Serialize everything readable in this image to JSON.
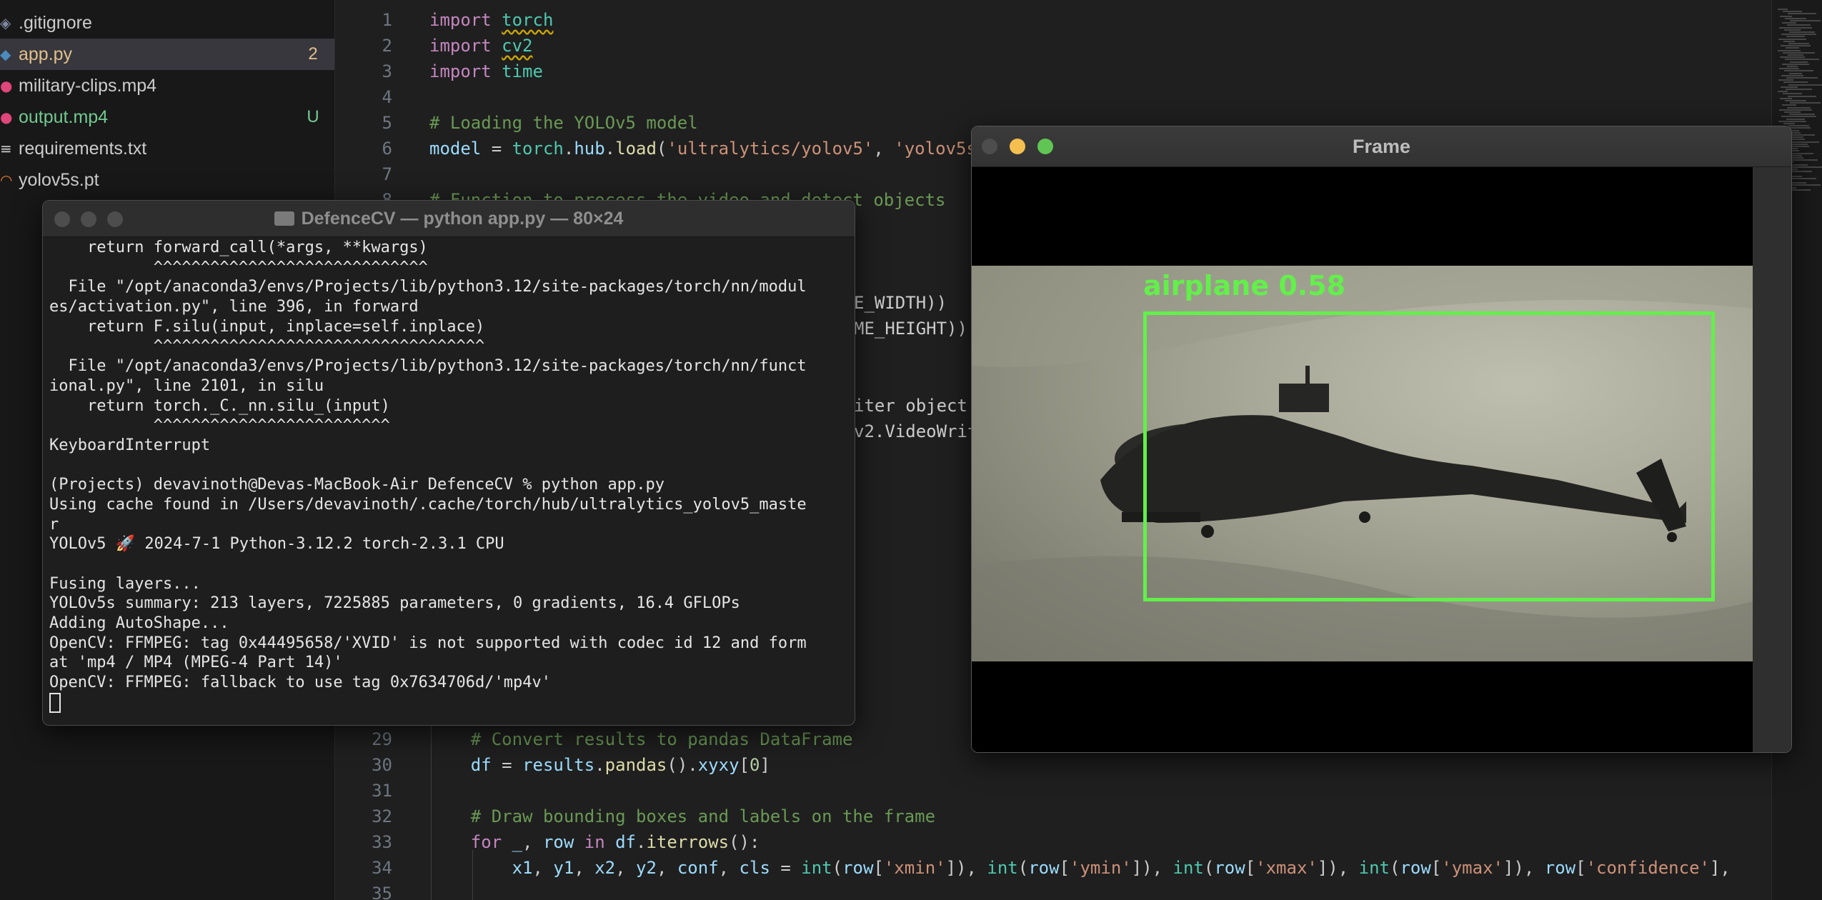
{
  "explorer": {
    "files": [
      {
        "name": ".gitignore",
        "icon": "gitignore-icon",
        "icon_glyph": "◈",
        "icon_color": "#7e8aa0",
        "color": "#cccccc",
        "badge": ""
      },
      {
        "name": "app.py",
        "icon": "python-file-icon",
        "icon_glyph": "◆",
        "icon_color": "#4b8bbe",
        "color": "#e2c08d",
        "badge": "2",
        "selected": true
      },
      {
        "name": "military-clips.mp4",
        "icon": "video-file-icon",
        "icon_glyph": "●",
        "icon_color": "#e0457b",
        "color": "#cccccc",
        "badge": ""
      },
      {
        "name": "output.mp4",
        "icon": "video-file-icon",
        "icon_glyph": "●",
        "icon_color": "#e0457b",
        "color": "#73c991",
        "badge": "U"
      },
      {
        "name": "requirements.txt",
        "icon": "text-file-icon",
        "icon_glyph": "≡",
        "icon_color": "#cccccc",
        "color": "#cccccc",
        "badge": ""
      },
      {
        "name": "yolov5s.pt",
        "icon": "rss-file-icon",
        "icon_glyph": "◠",
        "icon_color": "#e37933",
        "color": "#cccccc",
        "badge": ""
      }
    ]
  },
  "editor": {
    "top_lines": [
      {
        "n": "1",
        "tokens": [
          [
            "kw",
            "import "
          ],
          [
            "mod sq",
            "torch"
          ]
        ]
      },
      {
        "n": "2",
        "tokens": [
          [
            "kw",
            "import "
          ],
          [
            "mod sq",
            "cv2"
          ]
        ]
      },
      {
        "n": "3",
        "tokens": [
          [
            "kw",
            "import "
          ],
          [
            "mod",
            "time"
          ]
        ]
      },
      {
        "n": "4",
        "tokens": []
      },
      {
        "n": "5",
        "tokens": [
          [
            "cm",
            "# Loading the YOLOv5 model"
          ]
        ]
      },
      {
        "n": "6",
        "tokens": [
          [
            "var",
            "model"
          ],
          [
            "",
            " = "
          ],
          [
            "mod",
            "torch"
          ],
          [
            "",
            "."
          ],
          [
            "var",
            "hub"
          ],
          [
            "",
            "."
          ],
          [
            "fn",
            "load"
          ],
          [
            "",
            "("
          ],
          [
            "str",
            "'ultralytics/yolov5'"
          ],
          [
            "",
            ", "
          ],
          [
            "str",
            "'yolov5s'"
          ]
        ]
      },
      {
        "n": "7",
        "tokens": []
      },
      {
        "n": "8",
        "tokens": [
          [
            "cm",
            "# Function to process the video and detect objects"
          ]
        ]
      }
    ],
    "mid_fragments": [
      {
        "text": "E_WIDTH))",
        "line": 12
      },
      {
        "text": "ME_HEIGHT))",
        "line": 13
      },
      {
        "text": "iter object",
        "line": 16
      },
      {
        "text": "v2.VideoWrit",
        "line": 17
      }
    ],
    "bottom_lines": [
      {
        "n": "29",
        "tokens": [
          [
            "cm",
            "    # Convert results to pandas DataFrame"
          ]
        ]
      },
      {
        "n": "30",
        "tokens": [
          [
            "",
            "    "
          ],
          [
            "var",
            "df"
          ],
          [
            "",
            " = "
          ],
          [
            "var",
            "results"
          ],
          [
            "",
            "."
          ],
          [
            "fn",
            "pandas"
          ],
          [
            "",
            "()."
          ],
          [
            "var",
            "xyxy"
          ],
          [
            "",
            "["
          ],
          [
            "num",
            "0"
          ],
          [
            "",
            "]"
          ]
        ]
      },
      {
        "n": "31",
        "tokens": []
      },
      {
        "n": "32",
        "tokens": [
          [
            "cm",
            "    # Draw bounding boxes and labels on the frame"
          ]
        ]
      },
      {
        "n": "33",
        "tokens": [
          [
            "kw",
            "    for "
          ],
          [
            "var",
            "_"
          ],
          [
            "",
            ", "
          ],
          [
            "var",
            "row"
          ],
          [
            "kw",
            " in "
          ],
          [
            "var",
            "df"
          ],
          [
            "",
            "."
          ],
          [
            "fn",
            "iterrows"
          ],
          [
            "",
            "():"
          ]
        ]
      },
      {
        "n": "34",
        "tokens": [
          [
            "",
            "        "
          ],
          [
            "var",
            "x1"
          ],
          [
            "",
            ", "
          ],
          [
            "var",
            "y1"
          ],
          [
            "",
            ", "
          ],
          [
            "var",
            "x2"
          ],
          [
            "",
            ", "
          ],
          [
            "var",
            "y2"
          ],
          [
            "",
            ", "
          ],
          [
            "var",
            "conf"
          ],
          [
            "",
            ", "
          ],
          [
            "var",
            "cls"
          ],
          [
            "",
            " = "
          ],
          [
            "mod",
            "int"
          ],
          [
            "",
            "("
          ],
          [
            "var",
            "row"
          ],
          [
            "",
            "["
          ],
          [
            "str",
            "'xmin'"
          ],
          [
            "",
            "]), "
          ],
          [
            "mod",
            "int"
          ],
          [
            "",
            "("
          ],
          [
            "var",
            "row"
          ],
          [
            "",
            "["
          ],
          [
            "str",
            "'ymin'"
          ],
          [
            "",
            "]), "
          ],
          [
            "mod",
            "int"
          ],
          [
            "",
            "("
          ],
          [
            "var",
            "row"
          ],
          [
            "",
            "["
          ],
          [
            "str",
            "'xmax'"
          ],
          [
            "",
            "]), "
          ],
          [
            "mod",
            "int"
          ],
          [
            "",
            "("
          ],
          [
            "var",
            "row"
          ],
          [
            "",
            "["
          ],
          [
            "str",
            "'ymax'"
          ],
          [
            "",
            "]), "
          ],
          [
            "var",
            "row"
          ],
          [
            "",
            "["
          ],
          [
            "str",
            "'confidence'"
          ],
          [
            "",
            "],"
          ]
        ]
      },
      {
        "n": "35",
        "tokens": []
      }
    ]
  },
  "terminal": {
    "title": "DefenceCV — python app.py — 80×24",
    "lines": [
      "    return forward_call(*args, **kwargs)",
      "           ^^^^^^^^^^^^^^^^^^^^^^^^^^^^^",
      "  File \"/opt/anaconda3/envs/Projects/lib/python3.12/site-packages/torch/nn/modul",
      "es/activation.py\", line 396, in forward",
      "    return F.silu(input, inplace=self.inplace)",
      "           ^^^^^^^^^^^^^^^^^^^^^^^^^^^^^^^^^^^",
      "  File \"/opt/anaconda3/envs/Projects/lib/python3.12/site-packages/torch/nn/funct",
      "ional.py\", line 2101, in silu",
      "    return torch._C._nn.silu_(input)",
      "           ^^^^^^^^^^^^^^^^^^^^^^^^^",
      "KeyboardInterrupt",
      "",
      "(Projects) devavinoth@Devas-MacBook-Air DefenceCV % python app.py",
      "Using cache found in /Users/devavinoth/.cache/torch/hub/ultralytics_yolov5_maste",
      "r",
      "YOLOv5 🚀 2024-7-1 Python-3.12.2 torch-2.3.1 CPU",
      "",
      "Fusing layers...",
      "YOLOv5s summary: 213 layers, 7225885 parameters, 0 gradients, 16.4 GFLOPs",
      "Adding AutoShape...",
      "OpenCV: FFMPEG: tag 0x44495658/'XVID' is not supported with codec id 12 and form",
      "at 'mp4 / MP4 (MPEG-4 Part 14)'",
      "OpenCV: FFMPEG: fallback to use tag 0x7634706d/'mp4v'"
    ]
  },
  "frame_window": {
    "title": "Frame",
    "detection_label": "airplane 0.58",
    "box_color": "#62f04a"
  }
}
